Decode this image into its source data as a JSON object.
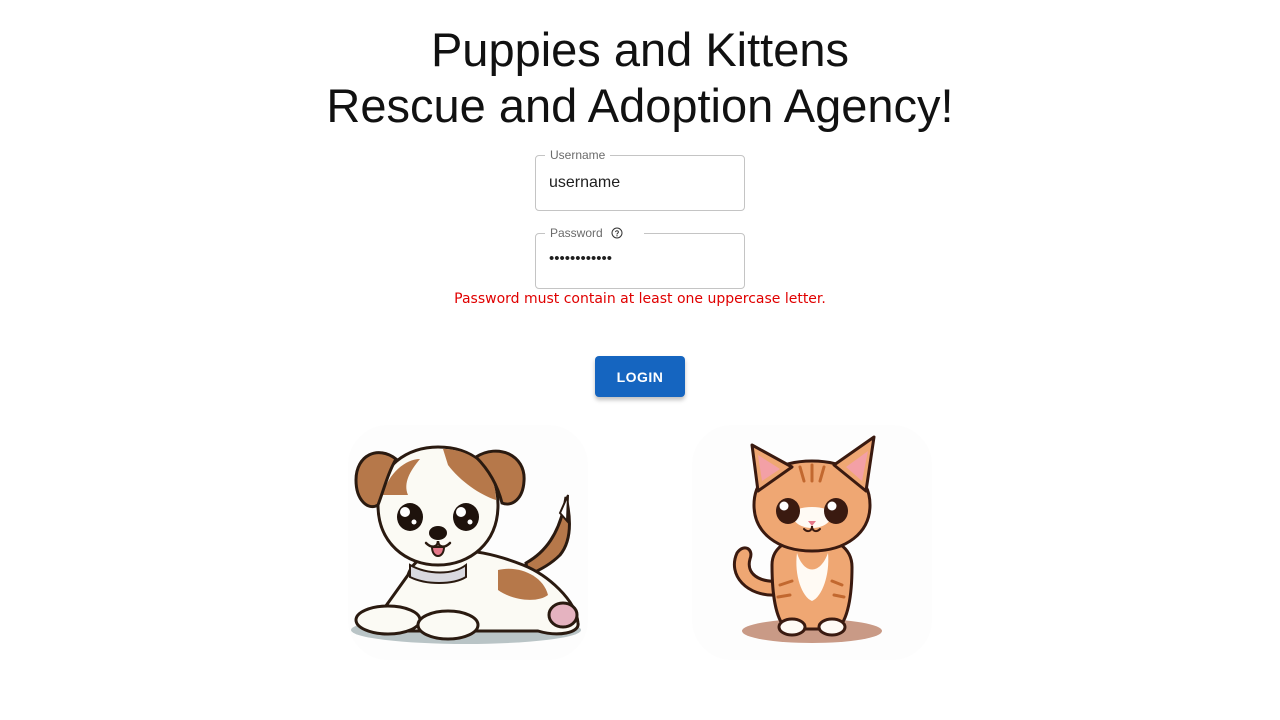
{
  "header": {
    "title_line1": "Puppies and Kittens",
    "title_line2": "Rescue and Adoption Agency!"
  },
  "form": {
    "username": {
      "label": "Username",
      "value": "username"
    },
    "password": {
      "label": "Password",
      "value": "••••••••••••",
      "help_icon": "help-circle-icon"
    },
    "error_message": "Password must contain at least one uppercase letter.",
    "login_label": "LOGIN"
  },
  "images": {
    "dog": "puppy-illustration",
    "cat": "kitten-illustration"
  },
  "colors": {
    "primary": "#1565c0",
    "error": "#e00000",
    "border": "#c4c4c4"
  }
}
